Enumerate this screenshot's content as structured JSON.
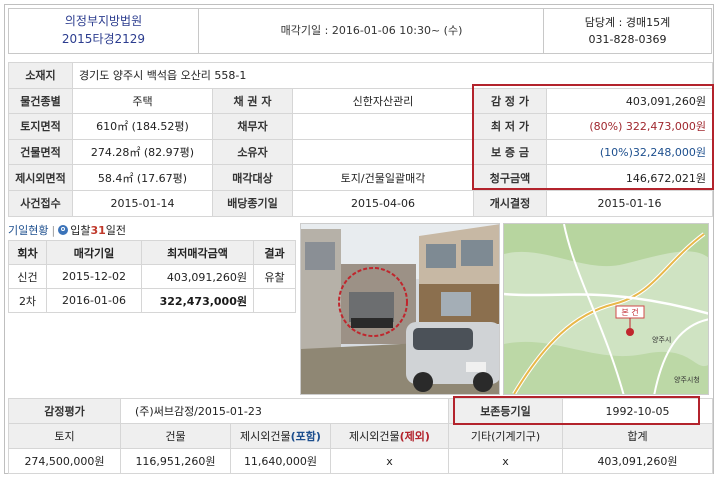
{
  "header": {
    "court": "의정부지방법원",
    "case_no": "2015타경2129",
    "auction_date": "매각기일 : 2016-01-06   10:30~ (수)",
    "team": "담당계 : 경매15계",
    "phone": "031-828-0369"
  },
  "info": {
    "location_label": "소재지",
    "location_value": "경기도 양주시 백석읍 오산리 558-1",
    "type_label": "물건종별",
    "type_value": "주택",
    "creditor_label": "채 권 자",
    "creditor_value": "신한자산관리",
    "appraisal_label": "감 정 가",
    "appraisal_value": "403,091,260원",
    "land_label": "토지면적",
    "land_value": "610㎡ (184.52평)",
    "debtor_label": "채무자",
    "debtor_value": "",
    "min_label": "최 저 가",
    "min_value": "(80%) 322,473,000원",
    "building_label": "건물면적",
    "building_value": "274.28㎡ (82.97평)",
    "owner_label": "소유자",
    "owner_value": "",
    "deposit_label": "보 증 금",
    "deposit_value": "(10%)32,248,000원",
    "excluded_label": "제시외면적",
    "excluded_value": "58.4㎡ (17.67평)",
    "target_label": "매각대상",
    "target_value": "토지/건물일괄매각",
    "claim_label": "청구금액",
    "claim_value": "146,672,021원",
    "receipt_label": "사건접수",
    "receipt_value": "2015-01-14",
    "dividend_label": "배당종기일",
    "dividend_value": "2015-04-06",
    "start_label": "개시결정",
    "start_value": "2015-01-16"
  },
  "history": {
    "tab1": "기일현황",
    "tab_sep": "|",
    "tab2_prefix": "입찰",
    "tab2_num": "31",
    "tab2_suffix": "일전",
    "headers": [
      "회차",
      "매각기일",
      "최저매각금액",
      "결과"
    ],
    "rows": [
      {
        "round": "신건",
        "date": "2015-12-02",
        "amount": "403,091,260원",
        "result": "유찰"
      },
      {
        "round": "2차",
        "date": "2016-01-06",
        "amount": "322,473,000원",
        "result": ""
      }
    ]
  },
  "valuation": {
    "label": "감정평가",
    "value": "(주)써브감정/2015-01-23",
    "preserve_label": "보존등기일",
    "preserve_value": "1992-10-05",
    "col_land": "토지",
    "col_building": "건물",
    "col_excl_prefix": "제시외건물",
    "col_excl_incl": "(포함)",
    "col_excl2_prefix": "제시외건물",
    "col_excl2_excl": "(제외)",
    "col_other": "기타(기계기구)",
    "col_total": "합계",
    "land": "274,500,000원",
    "building": "116,951,260원",
    "excl_incl": "11,640,000원",
    "excl_excl": "x",
    "other": "x",
    "total": "403,091,260원"
  },
  "map": {
    "label_1": "본 건",
    "label_2": "양주시",
    "label_3": "양주시청"
  },
  "colors": {
    "highlight": "#b3232c",
    "title_blue": "#2c3d8f",
    "label_bg": "#efefef"
  }
}
